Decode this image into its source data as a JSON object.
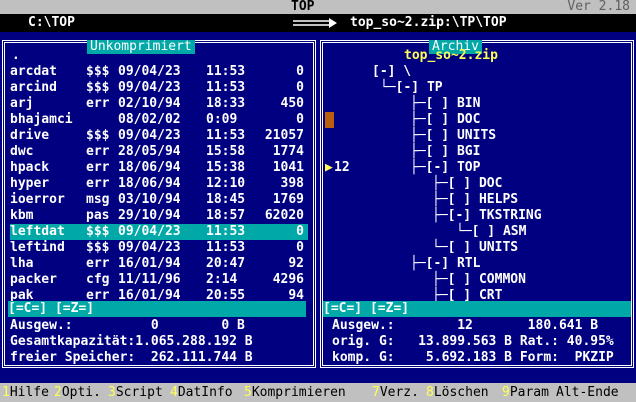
{
  "title": "TOP",
  "version": "Ver 2.18",
  "left_path": "C:\\TOP",
  "right_path": "top_so~2.zip:\\TP\\TOP",
  "left_panel": {
    "title": "Unkomprimiert",
    "first_row": ".",
    "files": [
      {
        "name": "arcdat",
        "ext": "$$$",
        "date": "09/04/23",
        "time": "11:53",
        "size": "0"
      },
      {
        "name": "arcind",
        "ext": "$$$",
        "date": "09/04/23",
        "time": "11:53",
        "size": "0"
      },
      {
        "name": "arj",
        "ext": "err",
        "date": "02/10/94",
        "time": "18:33",
        "size": "450"
      },
      {
        "name": "bhajamci",
        "ext": "",
        "date": "08/02/02",
        "time": "0:09",
        "size": "0"
      },
      {
        "name": "drive",
        "ext": "$$$",
        "date": "09/04/23",
        "time": "11:53",
        "size": "21057"
      },
      {
        "name": "dwc",
        "ext": "err",
        "date": "28/05/94",
        "time": "15:58",
        "size": "1774"
      },
      {
        "name": "hpack",
        "ext": "err",
        "date": "18/06/94",
        "time": "15:38",
        "size": "1041"
      },
      {
        "name": "hyper",
        "ext": "err",
        "date": "18/06/94",
        "time": "12:10",
        "size": "398"
      },
      {
        "name": "ioerror",
        "ext": "msg",
        "date": "03/10/94",
        "time": "18:45",
        "size": "1769"
      },
      {
        "name": "kbm",
        "ext": "pas",
        "date": "29/10/94",
        "time": "18:57",
        "size": "62020"
      },
      {
        "name": "leftdat",
        "ext": "$$$",
        "date": "09/04/23",
        "time": "11:53",
        "size": "0"
      },
      {
        "name": "leftind",
        "ext": "$$$",
        "date": "09/04/23",
        "time": "11:53",
        "size": "0"
      },
      {
        "name": "lha",
        "ext": "err",
        "date": "16/01/94",
        "time": "20:47",
        "size": "92"
      },
      {
        "name": "packer",
        "ext": "cfg",
        "date": "11/11/96",
        "time": "2:14",
        "size": "4296"
      },
      {
        "name": "pak",
        "ext": "err",
        "date": "16/01/94",
        "time": "20:55",
        "size": "94"
      }
    ],
    "selected_index": 10,
    "filter": "[=C=] [=Z=]",
    "stats": [
      "Ausgew.:          0        0 B",
      "Gesamtkapazität:1.065.288.192 B",
      "freier Speicher:  262.111.744 B"
    ]
  },
  "right_panel": {
    "title": "Archiv",
    "archive_name": "top_so~2.zip",
    "tree": [
      "[-] \\",
      "└─[-] TP",
      "├─[ ] BIN",
      "├─[ ] DOC",
      "├─[ ] UNITS",
      "├─[ ] BGI",
      "├─[-] TOP",
      "├─[ ] DOC",
      "├─[ ] HELPS",
      "├─[-] TKSTRING",
      "└─[ ] ASM",
      "└─[ ] UNITS",
      "├─[-] RTL",
      "├─[ ] COMMON",
      "├─[ ] CRT"
    ],
    "marker_count": "12",
    "filter": "[=C=] [=Z=]",
    "stats": [
      "Ausgew.:        12       180.641 B",
      "orig. G:   13.899.563 B Rat.: 40.95%",
      "komp. G:    5.692.183 B Form:  PKZIP"
    ]
  },
  "keys": [
    {
      "num": "1",
      "label": "Hilfe"
    },
    {
      "num": "2",
      "label": "Opti."
    },
    {
      "num": "3",
      "label": "Script"
    },
    {
      "num": "4",
      "label": "DatInfo"
    },
    {
      "num": "5",
      "label": "Komprimieren"
    },
    {
      "num": "7",
      "label": "Verz."
    },
    {
      "num": "8",
      "label": "Löschen"
    },
    {
      "num": "9",
      "label": "Param"
    },
    {
      "num": "X",
      "label": "Alt-Ende"
    }
  ],
  "colors": {
    "background": "#000080",
    "accent": "#00a8a8",
    "highlight": "#ffff55",
    "bar": "#c0c0c0"
  }
}
